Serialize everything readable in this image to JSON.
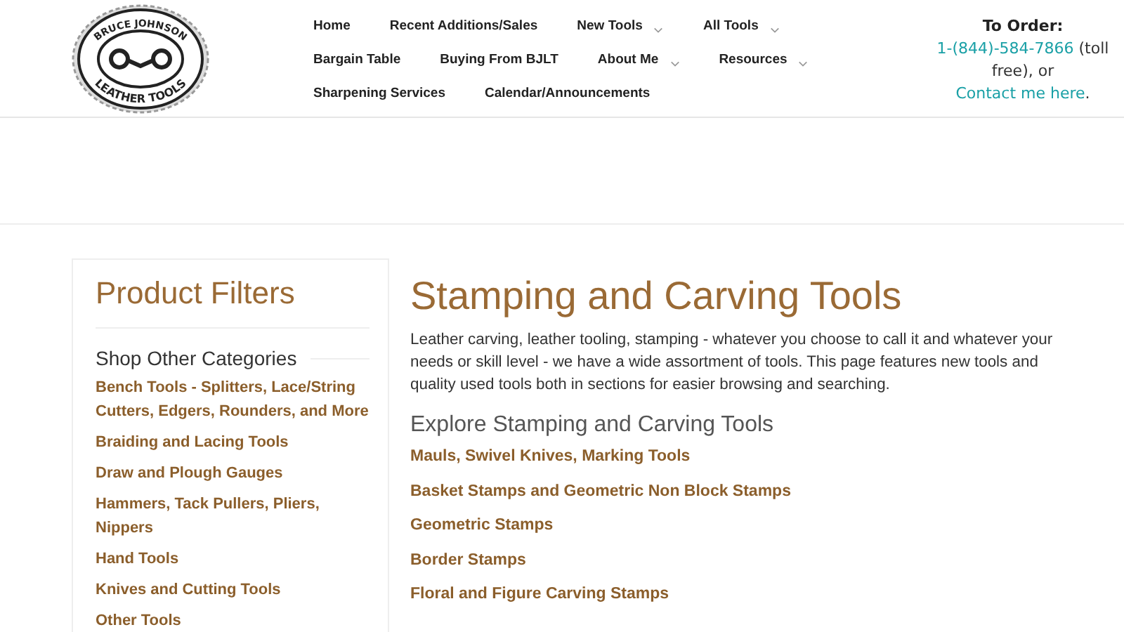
{
  "logo": {
    "top_text": "BRUCE JOHNSON",
    "bottom_text": "LEATHER TOOLS"
  },
  "nav": {
    "items": [
      {
        "label": "Home",
        "dropdown": false
      },
      {
        "label": "Recent Additions/Sales",
        "dropdown": false
      },
      {
        "label": "New Tools",
        "dropdown": true
      },
      {
        "label": "All Tools",
        "dropdown": true
      },
      {
        "label": "Bargain Table",
        "dropdown": false
      },
      {
        "label": "Buying From BJLT",
        "dropdown": false
      },
      {
        "label": "About Me",
        "dropdown": true
      },
      {
        "label": "Resources",
        "dropdown": true
      },
      {
        "label": "Sharpening Services",
        "dropdown": false
      },
      {
        "label": "Calendar/Announcements",
        "dropdown": false
      }
    ]
  },
  "order": {
    "label": "To Order:",
    "phone": "1-(844)-584-7866",
    "toll_free": "(toll free),",
    "or": "or",
    "contact": "Contact me here",
    "end": "."
  },
  "sidebar": {
    "title": "Product Filters",
    "section": "Shop Other Categories",
    "links": [
      "Bench Tools - Splitters, Lace/String Cutters, Edgers, Rounders, and More",
      "Braiding and Lacing Tools",
      "Draw and Plough Gauges",
      "Hammers, Tack Pullers, Pliers, Nippers",
      "Hand Tools",
      "Knives and Cutting Tools",
      "Other Tools"
    ]
  },
  "main": {
    "title": "Stamping and Carving Tools",
    "intro": "Leather carving, leather tooling, stamping - whatever you choose to call it and whatever your needs or skill level - we have a wide assortment of tools. This page features new tools and quality used tools both  in sections for easier browsing and searching.",
    "subtitle": "Explore Stamping and Carving Tools",
    "links": [
      "Mauls, Swivel Knives, Marking Tools",
      "Basket Stamps and Geometric Non Block Stamps",
      "Geometric Stamps",
      "Border Stamps",
      "Floral and Figure Carving Stamps"
    ]
  }
}
